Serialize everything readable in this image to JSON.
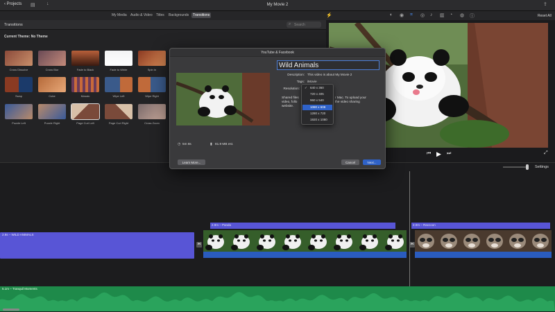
{
  "app": {
    "title": "My Movie 2",
    "back_label": "Projects"
  },
  "media_tabs": [
    {
      "label": "My Media",
      "active": false
    },
    {
      "label": "Audio & Video",
      "active": false
    },
    {
      "label": "Titles",
      "active": false
    },
    {
      "label": "Backgrounds",
      "active": false
    },
    {
      "label": "Transitions",
      "active": true
    }
  ],
  "viewer_toolbar": {
    "reset_label": "Reset All"
  },
  "browser": {
    "header": "Transitions",
    "search_placeholder": "Search",
    "current_theme": "Current Theme: No Theme",
    "transitions": [
      "Cross Dissolve",
      "Cross Blur",
      "Fade to Black",
      "Fade to White",
      "Spin In",
      "Swap",
      "Cube",
      "Mosaic",
      "Wipe Left",
      "Wipe Right",
      "Puzzle Left",
      "Puzzle Right",
      "Page Curl Left",
      "Page Curl Right",
      "Cross Zoom"
    ]
  },
  "dialog": {
    "title": "YouTube & Facebook",
    "name_value": "Wild Animals",
    "description_label": "Description:",
    "description_value": "This video is about My Movie 2",
    "tags_label": "Tags:",
    "tags_value": "iMovie",
    "resolution_label": "Resolution:",
    "shared_text_1": "Shared files",
    "shared_text_2": "video, follo",
    "shared_text_3": "website.",
    "shared_right_1": "r Mac. To upload your",
    "shared_right_2": "the video sharing",
    "duration": "5m 8s",
    "size": "81.9 MB est.",
    "learn_more": "Learn More...",
    "cancel": "Cancel",
    "next": "Next..."
  },
  "resolution_options": [
    {
      "label": "640 x 360",
      "checked": true
    },
    {
      "label": "720 x 405",
      "checked": false
    },
    {
      "label": "960 x 540",
      "checked": false
    },
    {
      "label": "1080 x 608",
      "selected": true
    },
    {
      "label": "1280 x 720",
      "checked": false
    },
    {
      "label": "1920 x 1080",
      "checked": false
    }
  ],
  "timeline": {
    "settings_label": "Settings",
    "title_clip": "2.9s – WILD ANIMALS",
    "clip_panda": "2.9m – Panda",
    "clip_raccoon": "2.0m – Raccoon",
    "audio_clip": "5.1m – Tranquil Moments"
  },
  "colors": {
    "accent": "#2f62c8",
    "title_clip": "#5855d6",
    "audio": "#1e8a4a"
  }
}
